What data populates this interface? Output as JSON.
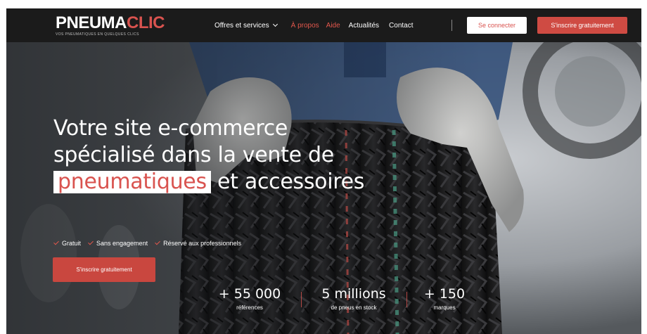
{
  "brand": {
    "name_part1": "PNEUMA",
    "name_part2": "CLIC",
    "tagline": "Vos pneumatiques en quelques clics"
  },
  "nav": {
    "items": [
      {
        "label": "Offres et services",
        "has_dropdown": true
      },
      {
        "label": "À propos"
      },
      {
        "label": "Aide"
      },
      {
        "label": "Actualités"
      },
      {
        "label": "Contact"
      }
    ],
    "login_label": "Se connecter",
    "signup_label": "S'inscrire gratuitement"
  },
  "hero": {
    "title_line1": "Votre site e-commerce",
    "title_line2": "spécialisé dans la vente de",
    "title_highlight": "pneumatiques",
    "title_line3_rest": " et accessoires",
    "checks": [
      "Gratuit",
      "Sans engagement",
      "Réservé aux professionnels"
    ],
    "cta_label": "S'inscrire gratuitement"
  },
  "stats": [
    {
      "value": "+ 55 000",
      "label": "références"
    },
    {
      "value": "5 millions",
      "label": "de pneus en stock"
    },
    {
      "value": "+ 150",
      "label": "marques"
    }
  ],
  "colors": {
    "accent": "#d9534f",
    "nav_bg": "#1b1b1b",
    "text_light": "#ffffff"
  }
}
